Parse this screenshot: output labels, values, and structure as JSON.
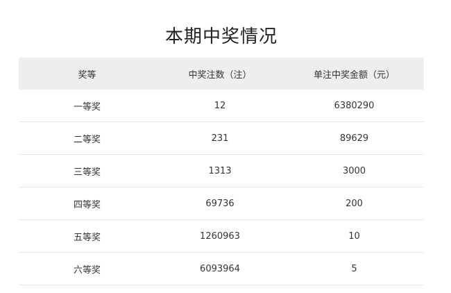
{
  "page": {
    "title": "本期中奖情况"
  },
  "table": {
    "headers": [
      "奖等",
      "中奖注数（注）",
      "单注中奖金额（元）"
    ],
    "rows": [
      {
        "level": "一等奖",
        "count": "12",
        "amount": "6380290"
      },
      {
        "level": "二等奖",
        "count": "231",
        "amount": "89629"
      },
      {
        "level": "三等奖",
        "count": "1313",
        "amount": "3000"
      },
      {
        "level": "四等奖",
        "count": "69736",
        "amount": "200"
      },
      {
        "level": "五等奖",
        "count": "1260963",
        "amount": "10"
      },
      {
        "level": "六等奖",
        "count": "6093964",
        "amount": "5"
      }
    ]
  },
  "colors": {
    "header_bg": "#eeeeee",
    "row_divider": "#e6e6e6",
    "text": "#333333",
    "title": "#222222"
  }
}
